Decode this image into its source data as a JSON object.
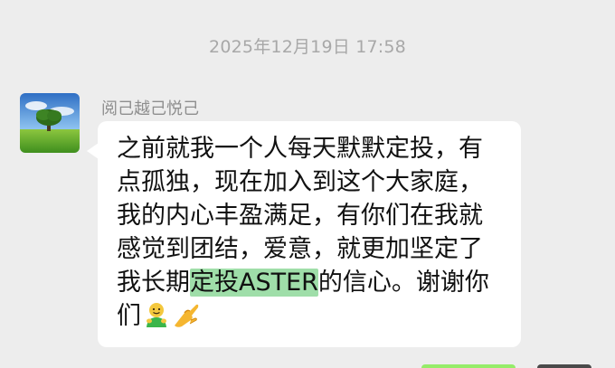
{
  "chat": {
    "timestamp": "2025年12月19日 17:58",
    "sender": {
      "name": "阅己越己悦己",
      "avatar_icon": "tree-landscape-avatar-icon"
    },
    "message": {
      "lines": [
        "之前就我一个人每天默默定投，有",
        "点孤独，现在加入到这个大家庭，",
        "我的内心丰盈满足，有你们在我就",
        "感觉到团结，爱意，就更加坚定了"
      ],
      "line5_before": "我长期",
      "line5_highlight": "定投ASTER",
      "line5_after": "的信心。谢谢你",
      "line6": "们",
      "emojis": [
        "hugging-person-emoji",
        "pinching-hand-emoji"
      ]
    }
  },
  "colors": {
    "background": "#ededed",
    "bubble": "#ffffff",
    "highlight": "#9fdea9",
    "timestamp": "#a8a8a8",
    "sender_name": "#8e8e8e"
  }
}
